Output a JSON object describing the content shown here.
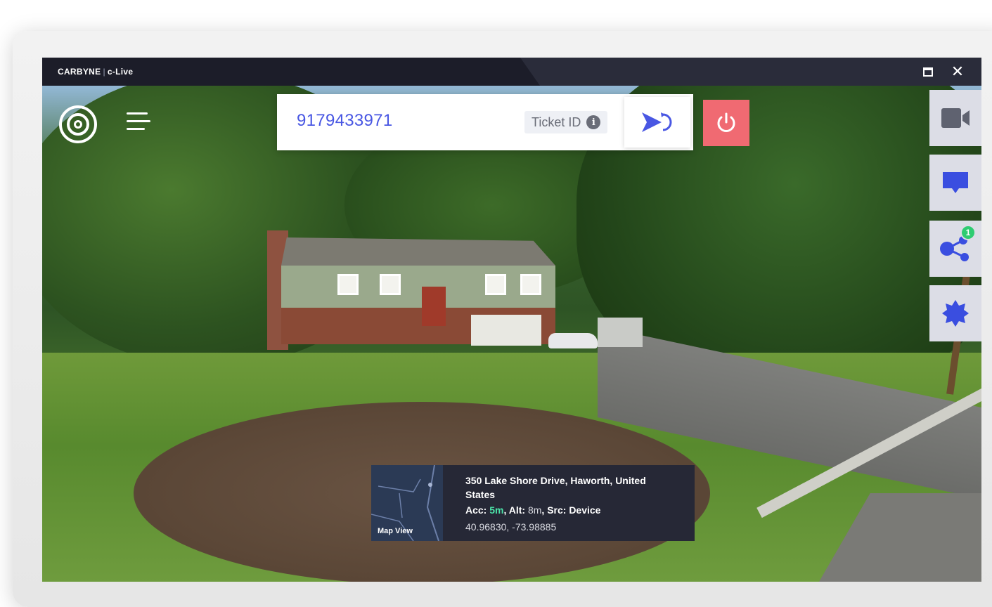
{
  "app": {
    "brand": "CARBYNE",
    "product": "c-Live"
  },
  "window_controls": {
    "maximize_icon": "maximize-icon",
    "close_glyph": "✕"
  },
  "call": {
    "phone_number": "9179433971",
    "ticket_placeholder": "Ticket ID",
    "info_glyph": "i"
  },
  "location": {
    "address": "350 Lake Shore Drive, Haworth, United States",
    "acc_label": "Acc:",
    "acc_value": "5m",
    "alt_label": ", Alt:",
    "alt_value": "8m",
    "src_label": ", Src: Device",
    "coordinates": "40.96830, -73.98885",
    "map_label": "Map View"
  },
  "side_panel": {
    "share_badge": "1"
  },
  "colors": {
    "accent": "#4957e3",
    "end_call": "#f06a72",
    "accuracy_green": "#4be3a8",
    "badge_green": "#2ecc71",
    "titlebar": "#1c1d29"
  }
}
